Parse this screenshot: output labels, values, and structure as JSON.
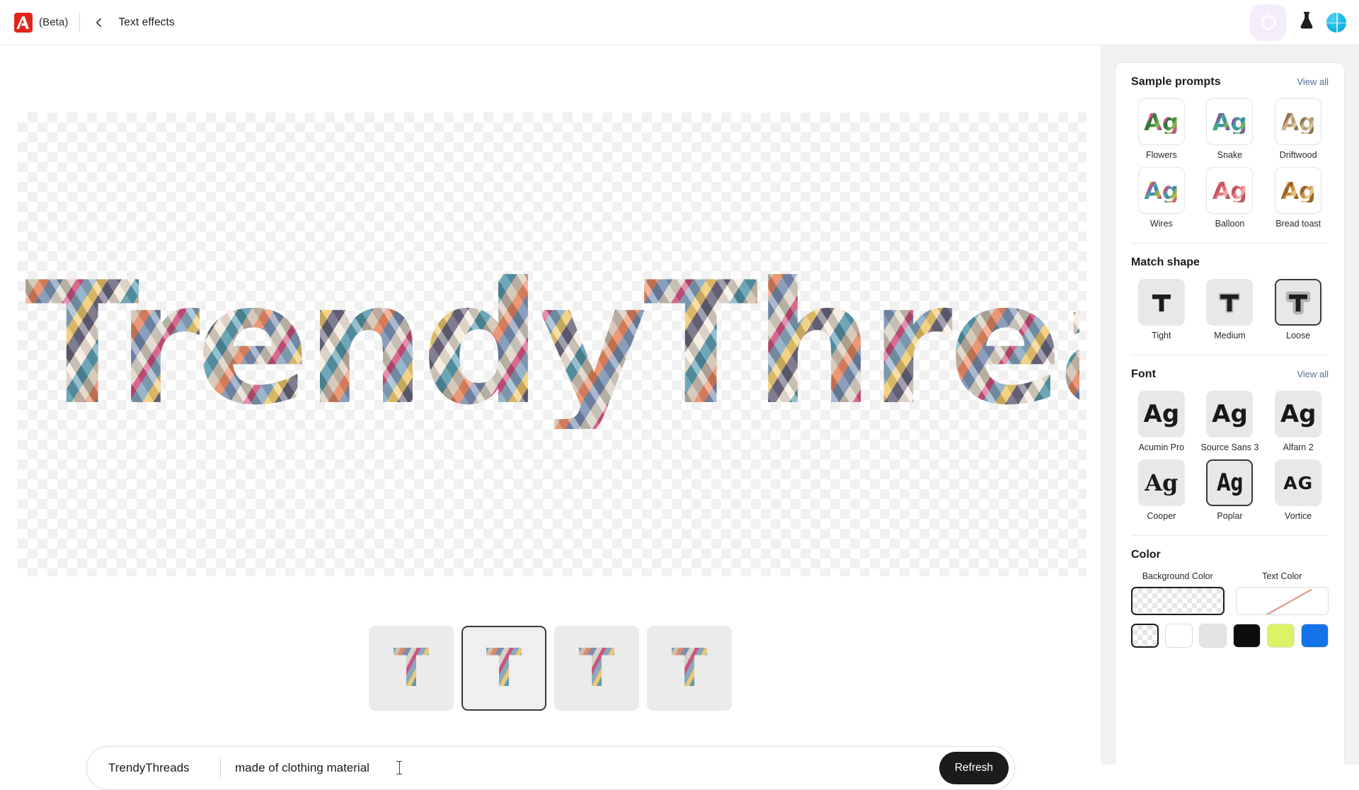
{
  "header": {
    "logo_icon": "adobe-logo-icon",
    "beta_label": "(Beta)",
    "back_icon": "chevron-left-icon",
    "page_title": "Text effects",
    "blob_icon": "firefly-logo-icon",
    "flask_icon": "beaker-flask-icon",
    "avatar_icon": "user-avatar"
  },
  "canvas": {
    "effect_text": "TrendyThreads",
    "background": "transparent-checkerboard"
  },
  "variations": {
    "items": [
      {
        "glyph": "T",
        "label": "variation-1",
        "selected": false
      },
      {
        "glyph": "T",
        "label": "variation-2",
        "selected": true
      },
      {
        "glyph": "T",
        "label": "variation-3",
        "selected": false
      },
      {
        "glyph": "T",
        "label": "variation-4",
        "selected": false
      }
    ]
  },
  "prompt_bar": {
    "text_value": "TrendyThreads",
    "prompt_value": "made of clothing material",
    "prompt_placeholder": "made of clothing material",
    "refresh_label": "Refresh"
  },
  "panel": {
    "sample_prompts": {
      "title": "Sample prompts",
      "view_all": "View all",
      "items": [
        {
          "label": "Flowers",
          "style": "ag-flowers"
        },
        {
          "label": "Snake",
          "style": "ag-snake"
        },
        {
          "label": "Driftwood",
          "style": "ag-driftwood"
        },
        {
          "label": "Wires",
          "style": "ag-wires"
        },
        {
          "label": "Balloon",
          "style": "ag-balloon"
        },
        {
          "label": "Bread toast",
          "style": "ag-bread"
        }
      ]
    },
    "match_shape": {
      "title": "Match shape",
      "items": [
        {
          "label": "Tight",
          "selected": false
        },
        {
          "label": "Medium",
          "selected": false
        },
        {
          "label": "Loose",
          "selected": true
        }
      ]
    },
    "font": {
      "title": "Font",
      "view_all": "View all",
      "items": [
        {
          "label": "Acumin Pro",
          "selected": false
        },
        {
          "label": "Source Sans 3",
          "selected": false
        },
        {
          "label": "Alfarn 2",
          "selected": false
        },
        {
          "label": "Cooper",
          "selected": false
        },
        {
          "label": "Poplar",
          "selected": true
        },
        {
          "label": "Vortice",
          "selected": false
        }
      ],
      "preview_text": "Ag",
      "preview_text_alt": "AG"
    },
    "color": {
      "title": "Color",
      "background_label": "Background Color",
      "text_label": "Text Color",
      "background_value": "transparent",
      "text_value": "none",
      "swatches": [
        {
          "name": "transparent",
          "hex": "transparent",
          "selected": true
        },
        {
          "name": "white",
          "hex": "#ffffff",
          "selected": false
        },
        {
          "name": "light-gray",
          "hex": "#e4e4e4",
          "selected": false
        },
        {
          "name": "black",
          "hex": "#0d0d0d",
          "selected": false
        },
        {
          "name": "lime",
          "hex": "#ddf264",
          "selected": false
        },
        {
          "name": "blue",
          "hex": "#1473e6",
          "selected": false
        }
      ]
    }
  },
  "colors": {
    "accent_link": "#4d6f99",
    "selected_border": "#3a3a3a",
    "button_dark": "#1b1b1b",
    "panel_bg": "#f2f2f2"
  }
}
